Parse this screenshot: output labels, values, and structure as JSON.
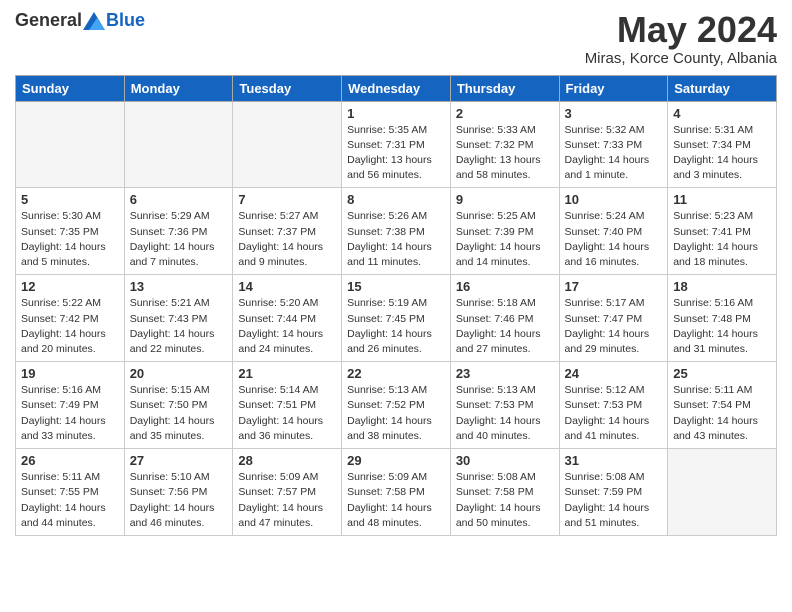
{
  "header": {
    "logo_general": "General",
    "logo_blue": "Blue",
    "month_title": "May 2024",
    "location": "Miras, Korce County, Albania"
  },
  "weekdays": [
    "Sunday",
    "Monday",
    "Tuesday",
    "Wednesday",
    "Thursday",
    "Friday",
    "Saturday"
  ],
  "weeks": [
    [
      {
        "day": "",
        "empty": true
      },
      {
        "day": "",
        "empty": true
      },
      {
        "day": "",
        "empty": true
      },
      {
        "day": "1",
        "sunrise": "Sunrise: 5:35 AM",
        "sunset": "Sunset: 7:31 PM",
        "daylight": "Daylight: 13 hours and 56 minutes."
      },
      {
        "day": "2",
        "sunrise": "Sunrise: 5:33 AM",
        "sunset": "Sunset: 7:32 PM",
        "daylight": "Daylight: 13 hours and 58 minutes."
      },
      {
        "day": "3",
        "sunrise": "Sunrise: 5:32 AM",
        "sunset": "Sunset: 7:33 PM",
        "daylight": "Daylight: 14 hours and 1 minute."
      },
      {
        "day": "4",
        "sunrise": "Sunrise: 5:31 AM",
        "sunset": "Sunset: 7:34 PM",
        "daylight": "Daylight: 14 hours and 3 minutes."
      }
    ],
    [
      {
        "day": "5",
        "sunrise": "Sunrise: 5:30 AM",
        "sunset": "Sunset: 7:35 PM",
        "daylight": "Daylight: 14 hours and 5 minutes."
      },
      {
        "day": "6",
        "sunrise": "Sunrise: 5:29 AM",
        "sunset": "Sunset: 7:36 PM",
        "daylight": "Daylight: 14 hours and 7 minutes."
      },
      {
        "day": "7",
        "sunrise": "Sunrise: 5:27 AM",
        "sunset": "Sunset: 7:37 PM",
        "daylight": "Daylight: 14 hours and 9 minutes."
      },
      {
        "day": "8",
        "sunrise": "Sunrise: 5:26 AM",
        "sunset": "Sunset: 7:38 PM",
        "daylight": "Daylight: 14 hours and 11 minutes."
      },
      {
        "day": "9",
        "sunrise": "Sunrise: 5:25 AM",
        "sunset": "Sunset: 7:39 PM",
        "daylight": "Daylight: 14 hours and 14 minutes."
      },
      {
        "day": "10",
        "sunrise": "Sunrise: 5:24 AM",
        "sunset": "Sunset: 7:40 PM",
        "daylight": "Daylight: 14 hours and 16 minutes."
      },
      {
        "day": "11",
        "sunrise": "Sunrise: 5:23 AM",
        "sunset": "Sunset: 7:41 PM",
        "daylight": "Daylight: 14 hours and 18 minutes."
      }
    ],
    [
      {
        "day": "12",
        "sunrise": "Sunrise: 5:22 AM",
        "sunset": "Sunset: 7:42 PM",
        "daylight": "Daylight: 14 hours and 20 minutes."
      },
      {
        "day": "13",
        "sunrise": "Sunrise: 5:21 AM",
        "sunset": "Sunset: 7:43 PM",
        "daylight": "Daylight: 14 hours and 22 minutes."
      },
      {
        "day": "14",
        "sunrise": "Sunrise: 5:20 AM",
        "sunset": "Sunset: 7:44 PM",
        "daylight": "Daylight: 14 hours and 24 minutes."
      },
      {
        "day": "15",
        "sunrise": "Sunrise: 5:19 AM",
        "sunset": "Sunset: 7:45 PM",
        "daylight": "Daylight: 14 hours and 26 minutes."
      },
      {
        "day": "16",
        "sunrise": "Sunrise: 5:18 AM",
        "sunset": "Sunset: 7:46 PM",
        "daylight": "Daylight: 14 hours and 27 minutes."
      },
      {
        "day": "17",
        "sunrise": "Sunrise: 5:17 AM",
        "sunset": "Sunset: 7:47 PM",
        "daylight": "Daylight: 14 hours and 29 minutes."
      },
      {
        "day": "18",
        "sunrise": "Sunrise: 5:16 AM",
        "sunset": "Sunset: 7:48 PM",
        "daylight": "Daylight: 14 hours and 31 minutes."
      }
    ],
    [
      {
        "day": "19",
        "sunrise": "Sunrise: 5:16 AM",
        "sunset": "Sunset: 7:49 PM",
        "daylight": "Daylight: 14 hours and 33 minutes."
      },
      {
        "day": "20",
        "sunrise": "Sunrise: 5:15 AM",
        "sunset": "Sunset: 7:50 PM",
        "daylight": "Daylight: 14 hours and 35 minutes."
      },
      {
        "day": "21",
        "sunrise": "Sunrise: 5:14 AM",
        "sunset": "Sunset: 7:51 PM",
        "daylight": "Daylight: 14 hours and 36 minutes."
      },
      {
        "day": "22",
        "sunrise": "Sunrise: 5:13 AM",
        "sunset": "Sunset: 7:52 PM",
        "daylight": "Daylight: 14 hours and 38 minutes."
      },
      {
        "day": "23",
        "sunrise": "Sunrise: 5:13 AM",
        "sunset": "Sunset: 7:53 PM",
        "daylight": "Daylight: 14 hours and 40 minutes."
      },
      {
        "day": "24",
        "sunrise": "Sunrise: 5:12 AM",
        "sunset": "Sunset: 7:53 PM",
        "daylight": "Daylight: 14 hours and 41 minutes."
      },
      {
        "day": "25",
        "sunrise": "Sunrise: 5:11 AM",
        "sunset": "Sunset: 7:54 PM",
        "daylight": "Daylight: 14 hours and 43 minutes."
      }
    ],
    [
      {
        "day": "26",
        "sunrise": "Sunrise: 5:11 AM",
        "sunset": "Sunset: 7:55 PM",
        "daylight": "Daylight: 14 hours and 44 minutes."
      },
      {
        "day": "27",
        "sunrise": "Sunrise: 5:10 AM",
        "sunset": "Sunset: 7:56 PM",
        "daylight": "Daylight: 14 hours and 46 minutes."
      },
      {
        "day": "28",
        "sunrise": "Sunrise: 5:09 AM",
        "sunset": "Sunset: 7:57 PM",
        "daylight": "Daylight: 14 hours and 47 minutes."
      },
      {
        "day": "29",
        "sunrise": "Sunrise: 5:09 AM",
        "sunset": "Sunset: 7:58 PM",
        "daylight": "Daylight: 14 hours and 48 minutes."
      },
      {
        "day": "30",
        "sunrise": "Sunrise: 5:08 AM",
        "sunset": "Sunset: 7:58 PM",
        "daylight": "Daylight: 14 hours and 50 minutes."
      },
      {
        "day": "31",
        "sunrise": "Sunrise: 5:08 AM",
        "sunset": "Sunset: 7:59 PM",
        "daylight": "Daylight: 14 hours and 51 minutes."
      },
      {
        "day": "",
        "empty": true
      }
    ]
  ]
}
